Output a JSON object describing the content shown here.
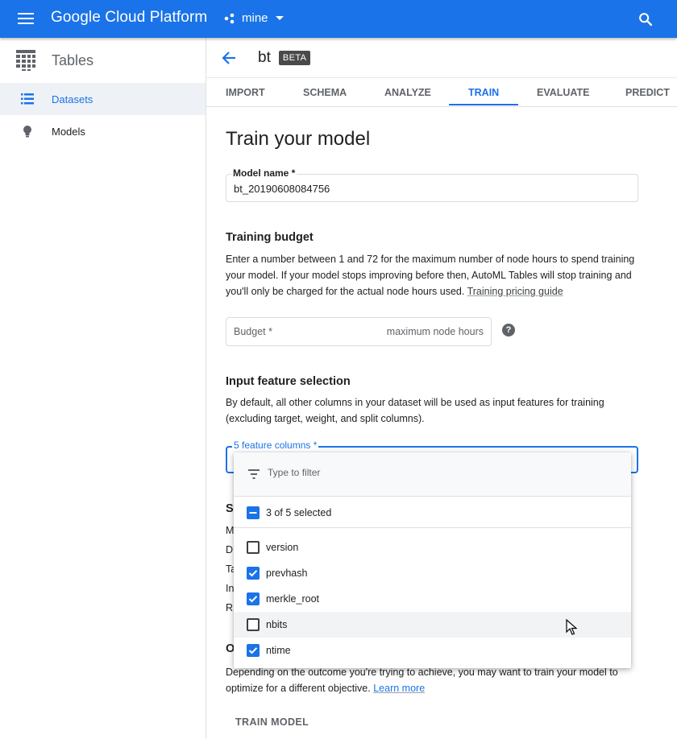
{
  "topbar": {
    "app_title": "Google Cloud Platform",
    "project": "mine"
  },
  "sidebar": {
    "product": "Tables",
    "items": [
      {
        "label": "Datasets",
        "icon": "list-icon",
        "active": true
      },
      {
        "label": "Models",
        "icon": "lightbulb-icon",
        "active": false
      }
    ]
  },
  "header": {
    "dataset_name": "bt",
    "badge": "BETA"
  },
  "tabs": [
    "IMPORT",
    "SCHEMA",
    "ANALYZE",
    "TRAIN",
    "EVALUATE",
    "PREDICT"
  ],
  "active_tab": "TRAIN",
  "page": {
    "title": "Train your model",
    "model_name": {
      "label": "Model name *",
      "value": "bt_20190608084756"
    },
    "budget": {
      "heading": "Training budget",
      "text": "Enter a number between 1 and 72 for the maximum number of node hours to spend training your model. If your model stops improving before then, AutoML Tables will stop training and you'll only be charged for the actual node hours used.",
      "link": "Training pricing guide",
      "field_label": "Budget *",
      "field_suffix": "maximum node hours"
    },
    "features": {
      "heading": "Input feature selection",
      "text": "By default, all other columns in your dataset will be used as input features for training (excluding target, weight, and split columns).",
      "field_label": "5 feature columns *"
    },
    "partial_letters": [
      "S",
      "M",
      "D",
      "Ta",
      "In",
      "R",
      "O"
    ],
    "objective": {
      "text": "Depending on the outcome you're trying to achieve, you may want to train your model to optimize for a different objective.",
      "link": "Learn more"
    },
    "train_button": "TRAIN MODEL"
  },
  "dropdown": {
    "filter_placeholder": "Type to filter",
    "selected_summary": "3 of 5 selected",
    "options": [
      {
        "label": "version",
        "checked": false
      },
      {
        "label": "prevhash",
        "checked": true
      },
      {
        "label": "merkle_root",
        "checked": true
      },
      {
        "label": "nbits",
        "checked": false
      },
      {
        "label": "ntime",
        "checked": true
      }
    ]
  },
  "colors": {
    "brand_blue": "#1a73e8",
    "active_bg": "#eef1f5"
  }
}
